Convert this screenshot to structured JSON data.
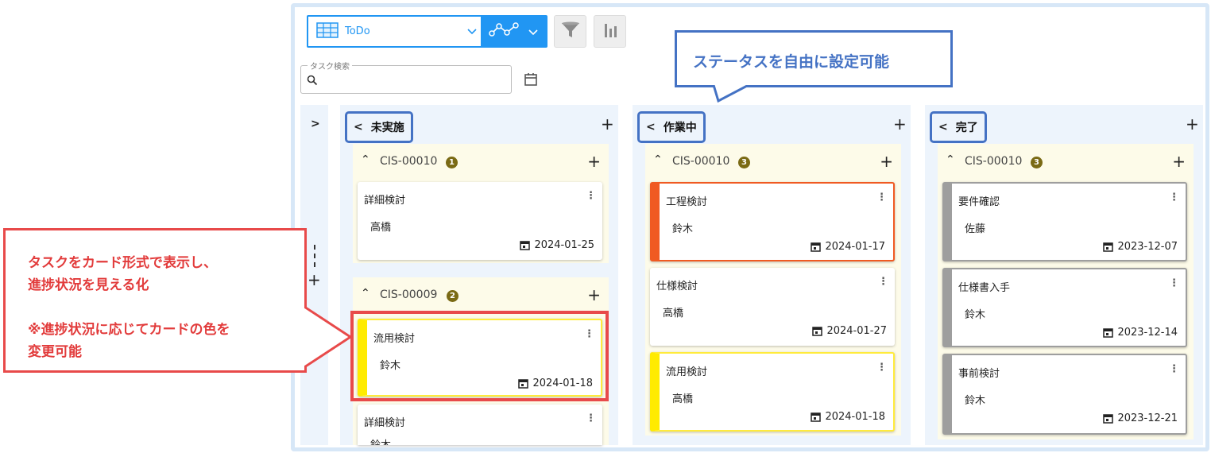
{
  "toolbar": {
    "view_label": "ToDo",
    "search_legend": "タスク検索",
    "search_placeholder": "",
    "search_value": ""
  },
  "columns": [
    {
      "title": "未実施",
      "groups": [
        {
          "name": "CIS-00010",
          "count": "1",
          "cards": [
            {
              "title": "詳細検討",
              "person": "高橋",
              "date": "2024-01-25",
              "accent": "none"
            }
          ]
        },
        {
          "name": "CIS-00009",
          "count": "2",
          "cards": [
            {
              "title": "流用検討",
              "person": "鈴木",
              "date": "2024-01-18",
              "accent": "yellow"
            },
            {
              "title": "詳細検討",
              "person": "鈴木",
              "date": "",
              "accent": "none"
            }
          ]
        }
      ]
    },
    {
      "title": "作業中",
      "groups": [
        {
          "name": "CIS-00010",
          "count": "3",
          "cards": [
            {
              "title": "工程検討",
              "person": "鈴木",
              "date": "2024-01-17",
              "accent": "orange"
            },
            {
              "title": "仕様検討",
              "person": "高橋",
              "date": "2024-01-27",
              "accent": "none"
            },
            {
              "title": "流用検討",
              "person": "高橋",
              "date": "2024-01-18",
              "accent": "yellow"
            }
          ]
        }
      ]
    },
    {
      "title": "完了",
      "groups": [
        {
          "name": "CIS-00010",
          "count": "3",
          "cards": [
            {
              "title": "要件確認",
              "person": "佐藤",
              "date": "2023-12-07",
              "accent": "gray"
            },
            {
              "title": "仕様書入手",
              "person": "鈴木",
              "date": "2023-12-14",
              "accent": "gray"
            },
            {
              "title": "事前検討",
              "person": "鈴木",
              "date": "2023-12-21",
              "accent": "gray"
            }
          ]
        }
      ]
    }
  ],
  "callouts": {
    "status": "ステータスを自由に設定可能",
    "card_line1": "タスクをカード形式で表示し、",
    "card_line2": "進捗状況を見える化",
    "card_line3": "※進捗状況に応じてカードの色を",
    "card_line4": "変更可能"
  },
  "colors": {
    "primary": "#2196f3",
    "column_bg": "#edf4fc",
    "group_bg": "#fdfbe9",
    "accent_orange": "#f05a22",
    "accent_yellow": "#ffeb00",
    "accent_gray": "#9e9e9e",
    "callout_red": "#e84a4a",
    "callout_blue": "#4472c4"
  },
  "icons": {
    "view": "table-icon",
    "visualization": "line-chart-icon",
    "filter": "filter-icon",
    "chart": "bar-chart-icon",
    "calendar": "calendar-icon",
    "search": "search-icon"
  }
}
